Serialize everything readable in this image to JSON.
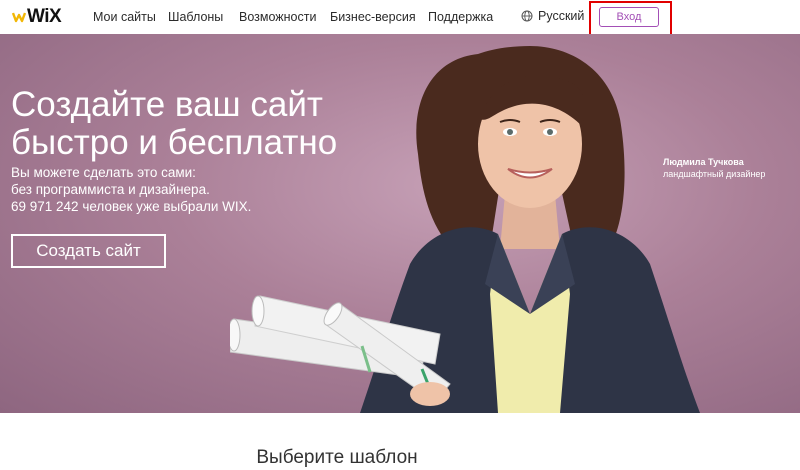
{
  "header": {
    "logo_text": "WiX",
    "nav": [
      {
        "label": "Мои сайты"
      },
      {
        "label": "Шаблоны"
      },
      {
        "label": "Возможности"
      },
      {
        "label": "Бизнес-версия"
      },
      {
        "label": "Поддержка"
      }
    ],
    "language": "Русский",
    "login_label": "Вход"
  },
  "hero": {
    "title_line1": "Создайте ваш сайт",
    "title_line2": "быстро и бесплатно",
    "subtitle_lines": [
      "Вы можете сделать это сами:",
      "без программиста и дизайнера.",
      "69 971 242 человек уже выбрали WIX."
    ],
    "cta_label": "Создать сайт",
    "person_name": "Людмила Тучкова",
    "person_role": "ландшафтный дизайнер"
  },
  "section": {
    "title": "Выберите шаблон"
  },
  "icons": {
    "logo": "wix-crown-logo-icon",
    "language": "globe-icon"
  },
  "colors": {
    "accent": "#a34fb6",
    "highlight": "#e10000",
    "hero_bg": "#ab8098"
  }
}
